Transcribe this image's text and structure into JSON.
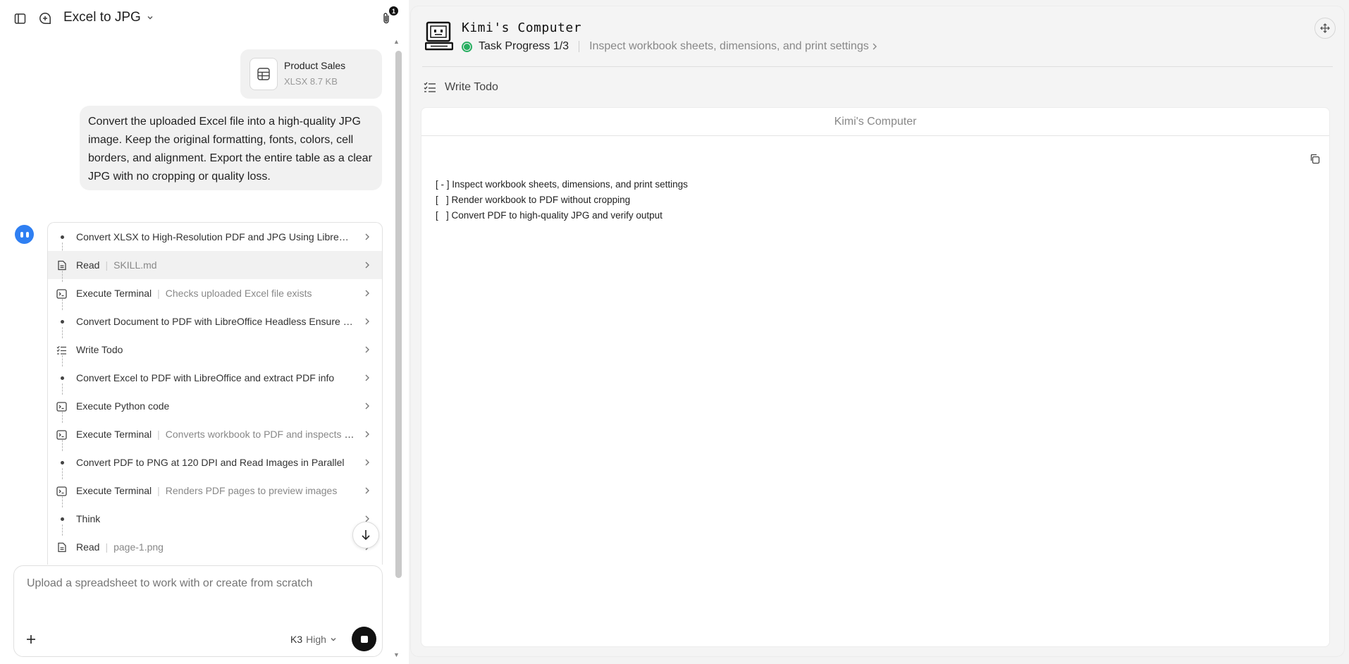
{
  "header": {
    "title": "Excel to JPG",
    "attachment_count": "1"
  },
  "attachment": {
    "name": "Product Sales",
    "meta": "XLSX 8.7 KB"
  },
  "user_message": "Convert the uploaded Excel file into a high-quality JPG image. Keep the original formatting, fonts, colors, cell borders, and alignment. Export the entire table as a clear JPG with no cropping or quality loss.",
  "steps": [
    {
      "kind": "dot",
      "label": "Convert XLSX to High-Resolution PDF and JPG Using LibreOffi...",
      "sub": ""
    },
    {
      "kind": "file",
      "label": "Read",
      "sub": "SKILL.md",
      "highlight": true
    },
    {
      "kind": "terminal",
      "label": "Execute Terminal",
      "sub": "Checks uploaded Excel file exists"
    },
    {
      "kind": "dot",
      "label": "Convert Document to PDF with LibreOffice Headless Ensure O...",
      "sub": ""
    },
    {
      "kind": "todo",
      "label": "Write Todo",
      "sub": ""
    },
    {
      "kind": "dot",
      "label": "Convert Excel to PDF with LibreOffice and extract PDF info",
      "sub": ""
    },
    {
      "kind": "terminal",
      "label": "Execute Python code",
      "sub": ""
    },
    {
      "kind": "terminal",
      "label": "Execute Terminal",
      "sub": "Converts workbook to PDF and inspects pa..."
    },
    {
      "kind": "dot",
      "label": "Convert PDF to PNG at 120 DPI and Read Images in Parallel",
      "sub": ""
    },
    {
      "kind": "terminal",
      "label": "Execute Terminal",
      "sub": "Renders PDF pages to preview images"
    },
    {
      "kind": "dot",
      "label": "Think",
      "sub": ""
    },
    {
      "kind": "file",
      "label": "Read",
      "sub": "page-1.png"
    }
  ],
  "composer": {
    "placeholder": "Upload a spreadsheet to work with or create from scratch",
    "model": "K3",
    "level": "High"
  },
  "computer": {
    "title": "Kimi's Computer",
    "progress": "Task Progress 1/3",
    "current_task": "Inspect workbook sheets, dimensions, and print settings",
    "tool_label": "Write Todo",
    "viewer_title": "Kimi's Computer",
    "todos": [
      "[ - ] Inspect workbook sheets, dimensions, and print settings",
      "[   ] Render workbook to PDF without cropping",
      "[   ] Convert PDF to high-quality JPG and verify output"
    ]
  },
  "colors": {
    "accent_blue": "#2f7ff2",
    "status_green": "#27ae60"
  }
}
